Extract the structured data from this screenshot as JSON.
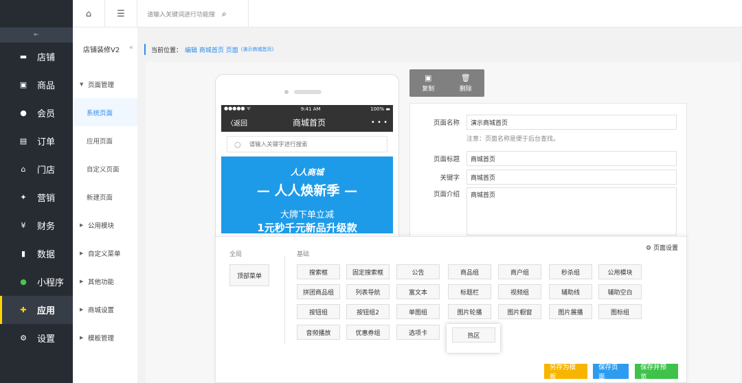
{
  "topbar": {
    "home_icon": "home-icon",
    "menu_icon": "menu-icon",
    "search_placeholder": "请输入关键词进行功能搜",
    "search_icon": "search-icon"
  },
  "sidebar": {
    "collapse_icon": "collapse-icon",
    "items": [
      {
        "label": "店铺",
        "icon": "store-icon"
      },
      {
        "label": "商品",
        "icon": "goods-icon"
      },
      {
        "label": "会员",
        "icon": "member-icon"
      },
      {
        "label": "订单",
        "icon": "order-icon"
      },
      {
        "label": "门店",
        "icon": "shop-icon"
      },
      {
        "label": "营销",
        "icon": "marketing-icon"
      },
      {
        "label": "财务",
        "icon": "finance-icon"
      },
      {
        "label": "数据",
        "icon": "data-icon"
      },
      {
        "label": "小程序",
        "icon": "miniprogram-icon"
      },
      {
        "label": "应用",
        "icon": "app-icon"
      },
      {
        "label": "设置",
        "icon": "settings-icon"
      }
    ],
    "active_index": 9,
    "accent": "#ffd400"
  },
  "submenu": {
    "title": "店铺装修V2",
    "collapse_arrow": "«",
    "items": [
      {
        "label": "页面管理",
        "type": "group",
        "open": true
      },
      {
        "label": "系统页面",
        "type": "child",
        "current": true
      },
      {
        "label": "应用页面",
        "type": "child"
      },
      {
        "label": "自定义页面",
        "type": "child"
      },
      {
        "label": "新建页面",
        "type": "child"
      },
      {
        "label": "公用模块",
        "type": "group"
      },
      {
        "label": "自定义菜单",
        "type": "group"
      },
      {
        "label": "其他功能",
        "type": "group"
      },
      {
        "label": "商城设置",
        "type": "group"
      },
      {
        "label": "模板管理",
        "type": "group"
      }
    ]
  },
  "breadcrumb": {
    "prefix": "当前位置：",
    "path": "编辑 商城首页 页面",
    "sub": "(演示商城首页)"
  },
  "phone": {
    "status_left": "●●●●● ᯤ",
    "status_time": "9:41 AM",
    "status_right": "100% ▬",
    "back": "〈返回",
    "title": "商城首页",
    "more": "• • •",
    "search_placeholder": "请输入关键字进行搜索",
    "banner_brand": "人人商城",
    "banner_title": "— 人人焕新季 —",
    "banner_sub": "大牌下单立减",
    "banner_promo": "1元秒千元新品升级款",
    "banner_color": "#1e9be8"
  },
  "actions": {
    "copy": "复制",
    "delete": "删除"
  },
  "form": {
    "name_label": "页面名称",
    "name_value": "演示商城首页",
    "name_note": "注意：页面名称是便于后台查找。",
    "title_label": "页面标题",
    "title_value": "商城首页",
    "keyword_label": "关键字",
    "keyword_value": "商城首页",
    "intro_label": "页面介绍",
    "intro_value": "商城首页"
  },
  "picker": {
    "global_label": "全局",
    "basic_label": "基础",
    "page_settings": "页面设置",
    "global_items": [
      "顶部菜单"
    ],
    "rows": [
      [
        "搜索框",
        "固定搜索框",
        "公告",
        "商品组",
        "商户组",
        "秒杀组",
        "公用模块"
      ],
      [
        "拼团商品组",
        "列表导航",
        "富文本",
        "标题栏",
        "视频组",
        "辅助线",
        "辅助空白"
      ],
      [
        "按钮组",
        "按钮组2",
        "单图组",
        "图片轮播",
        "图片橱窗",
        "图片展播",
        "图标组"
      ],
      [
        "音频播放",
        "优惠券组",
        "选项卡"
      ]
    ],
    "hot_zone": "热区"
  },
  "footer": {
    "save_template": "另存为模板",
    "save_page": "保存页面",
    "save_preview": "保存并预览",
    "colors": {
      "template": "#f7b500",
      "page": "#2d9cf0",
      "preview": "#3fc24a"
    }
  }
}
